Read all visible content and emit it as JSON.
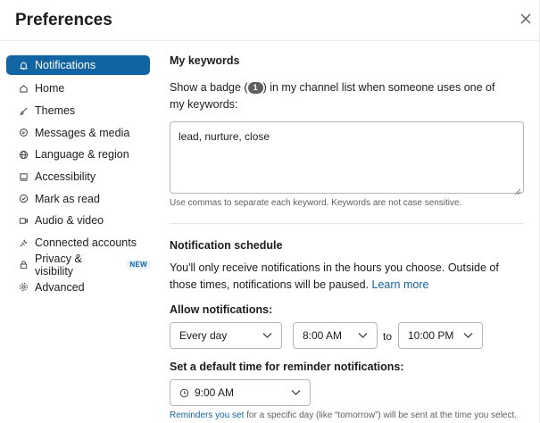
{
  "header": {
    "title": "Preferences"
  },
  "sidebar": {
    "items": [
      {
        "label": "Notifications",
        "icon": "bell-icon",
        "active": true
      },
      {
        "label": "Home",
        "icon": "home-icon"
      },
      {
        "label": "Themes",
        "icon": "brush-icon"
      },
      {
        "label": "Messages & media",
        "icon": "message-icon"
      },
      {
        "label": "Language & region",
        "icon": "globe-icon"
      },
      {
        "label": "Accessibility",
        "icon": "accessibility-icon"
      },
      {
        "label": "Mark as read",
        "icon": "check-circle-icon"
      },
      {
        "label": "Audio & video",
        "icon": "video-icon"
      },
      {
        "label": "Connected accounts",
        "icon": "plug-icon"
      },
      {
        "label": "Privacy & visibility",
        "icon": "lock-icon",
        "badge": "NEW"
      },
      {
        "label": "Advanced",
        "icon": "gear-icon"
      }
    ]
  },
  "keywords": {
    "title": "My keywords",
    "desc_before": "Show a badge (",
    "badge": "1",
    "desc_after": ") in my channel list when someone uses one of my keywords:",
    "value": "lead, nurture, close",
    "hint": "Use commas to separate each keyword. Keywords are not case sensitive."
  },
  "schedule": {
    "title": "Notification schedule",
    "desc": "You'll only receive notifications in the hours you choose. Outside of those times, notifications will be paused.",
    "learn_more": "Learn more",
    "allow_label": "Allow notifications:",
    "frequency": "Every day",
    "start_time": "8:00 AM",
    "to": "to",
    "end_time": "10:00 PM",
    "reminder_label": "Set a default time for reminder notifications:",
    "reminder_time": "9:00 AM",
    "footnote_link": "Reminders you set",
    "footnote_text": " for a specific day (like “tomorrow”) will be sent at the time you select."
  },
  "colors": {
    "accent": "#1264a3",
    "active_text": "#ffffff",
    "muted": "#616061"
  }
}
